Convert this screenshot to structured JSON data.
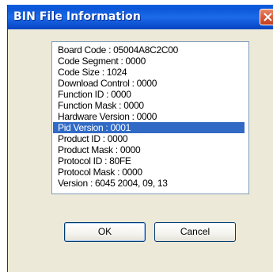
{
  "window": {
    "title": "BIN File Information",
    "close_icon": "close-icon"
  },
  "info_list": {
    "items": [
      {
        "label": "Board Code : 05004A8C2C00",
        "selected": false
      },
      {
        "label": "Code Segment : 0000",
        "selected": false
      },
      {
        "label": "Code Size : 1024",
        "selected": false
      },
      {
        "label": "Download Control : 0000",
        "selected": false
      },
      {
        "label": "Function ID : 0000",
        "selected": false
      },
      {
        "label": "Function Mask : 0000",
        "selected": false
      },
      {
        "label": "Hardware Version : 0000",
        "selected": false
      },
      {
        "label": "Pid Version : 0001",
        "selected": true
      },
      {
        "label": "Product ID : 0000",
        "selected": false
      },
      {
        "label": "Product Mask : 0000",
        "selected": false
      },
      {
        "label": "Protocol ID : 80FE",
        "selected": false
      },
      {
        "label": "Protocol Mask : 0000",
        "selected": false
      },
      {
        "label": "Version : 6045  2004, 09, 13",
        "selected": false
      }
    ]
  },
  "buttons": {
    "ok_label": "OK",
    "cancel_label": "Cancel"
  },
  "colors": {
    "titlebar": "#0B56D8",
    "selection": "#316AC5",
    "dialog_bg": "#ECE9D8",
    "close_button": "#D85A3A"
  }
}
